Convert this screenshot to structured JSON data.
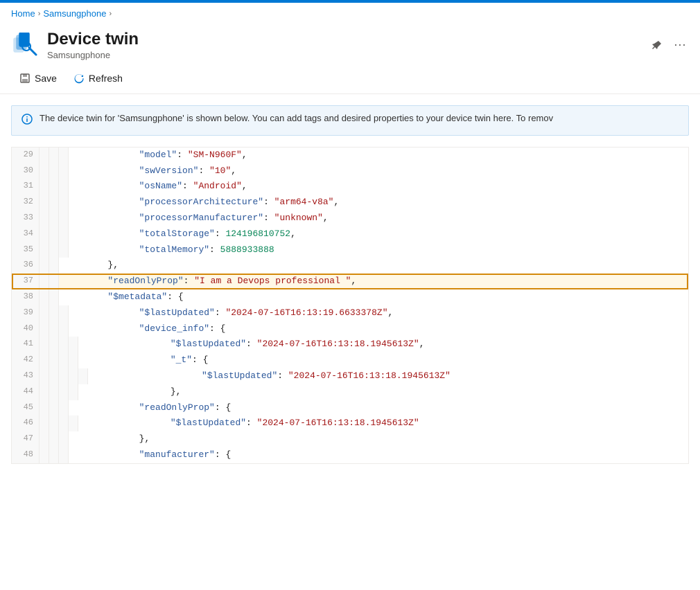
{
  "topBar": {
    "color": "#0078d4"
  },
  "breadcrumb": {
    "items": [
      "Home",
      "Samsungphone"
    ]
  },
  "header": {
    "title": "Device twin",
    "subtitle": "Samsungphone",
    "pinIcon": "📌",
    "moreIcon": "..."
  },
  "toolbar": {
    "save_label": "Save",
    "refresh_label": "Refresh"
  },
  "infoBanner": {
    "text": "The device twin for 'Samsungphone' is shown below. You can add tags and desired properties to your device twin here. To remov"
  },
  "codeLines": [
    {
      "num": 29,
      "indent": 4,
      "content": "\"model\": \"SM-N960F\","
    },
    {
      "num": 30,
      "indent": 4,
      "content": "\"swVersion\": \"10\","
    },
    {
      "num": 31,
      "indent": 4,
      "content": "\"osName\": \"Android\","
    },
    {
      "num": 32,
      "indent": 4,
      "content": "\"processorArchitecture\": \"arm64-v8a\","
    },
    {
      "num": 33,
      "indent": 4,
      "content": "\"processorManufacturer\": \"unknown\","
    },
    {
      "num": 34,
      "indent": 4,
      "content": "\"totalStorage\": 124196810752,"
    },
    {
      "num": 35,
      "indent": 4,
      "content": "\"totalMemory\": 5888933888"
    },
    {
      "num": 36,
      "indent": 3,
      "content": "},"
    },
    {
      "num": 37,
      "indent": 3,
      "content": "\"readOnlyProp\": \"I am a Devops professional \",",
      "highlighted": true
    },
    {
      "num": 38,
      "indent": 3,
      "content": "\"$metadata\": {"
    },
    {
      "num": 39,
      "indent": 4,
      "content": "\"$lastUpdated\": \"2024-07-16T16:13:19.6633378Z\","
    },
    {
      "num": 40,
      "indent": 4,
      "content": "\"device_info\": {"
    },
    {
      "num": 41,
      "indent": 5,
      "content": "\"$lastUpdated\": \"2024-07-16T16:13:18.1945613Z\","
    },
    {
      "num": 42,
      "indent": 5,
      "content": "\"_t\": {"
    },
    {
      "num": 43,
      "indent": 6,
      "content": "\"$lastUpdated\": \"2024-07-16T16:13:18.1945613Z\""
    },
    {
      "num": 44,
      "indent": 5,
      "content": "},"
    },
    {
      "num": 45,
      "indent": 4,
      "content": "\"readOnlyProp\": {"
    },
    {
      "num": 46,
      "indent": 5,
      "content": "\"$lastUpdated\": \"2024-07-16T16:13:18.1945613Z\""
    },
    {
      "num": 47,
      "indent": 4,
      "content": "},"
    },
    {
      "num": 48,
      "indent": 4,
      "content": "\"manufacturer\": {"
    }
  ]
}
